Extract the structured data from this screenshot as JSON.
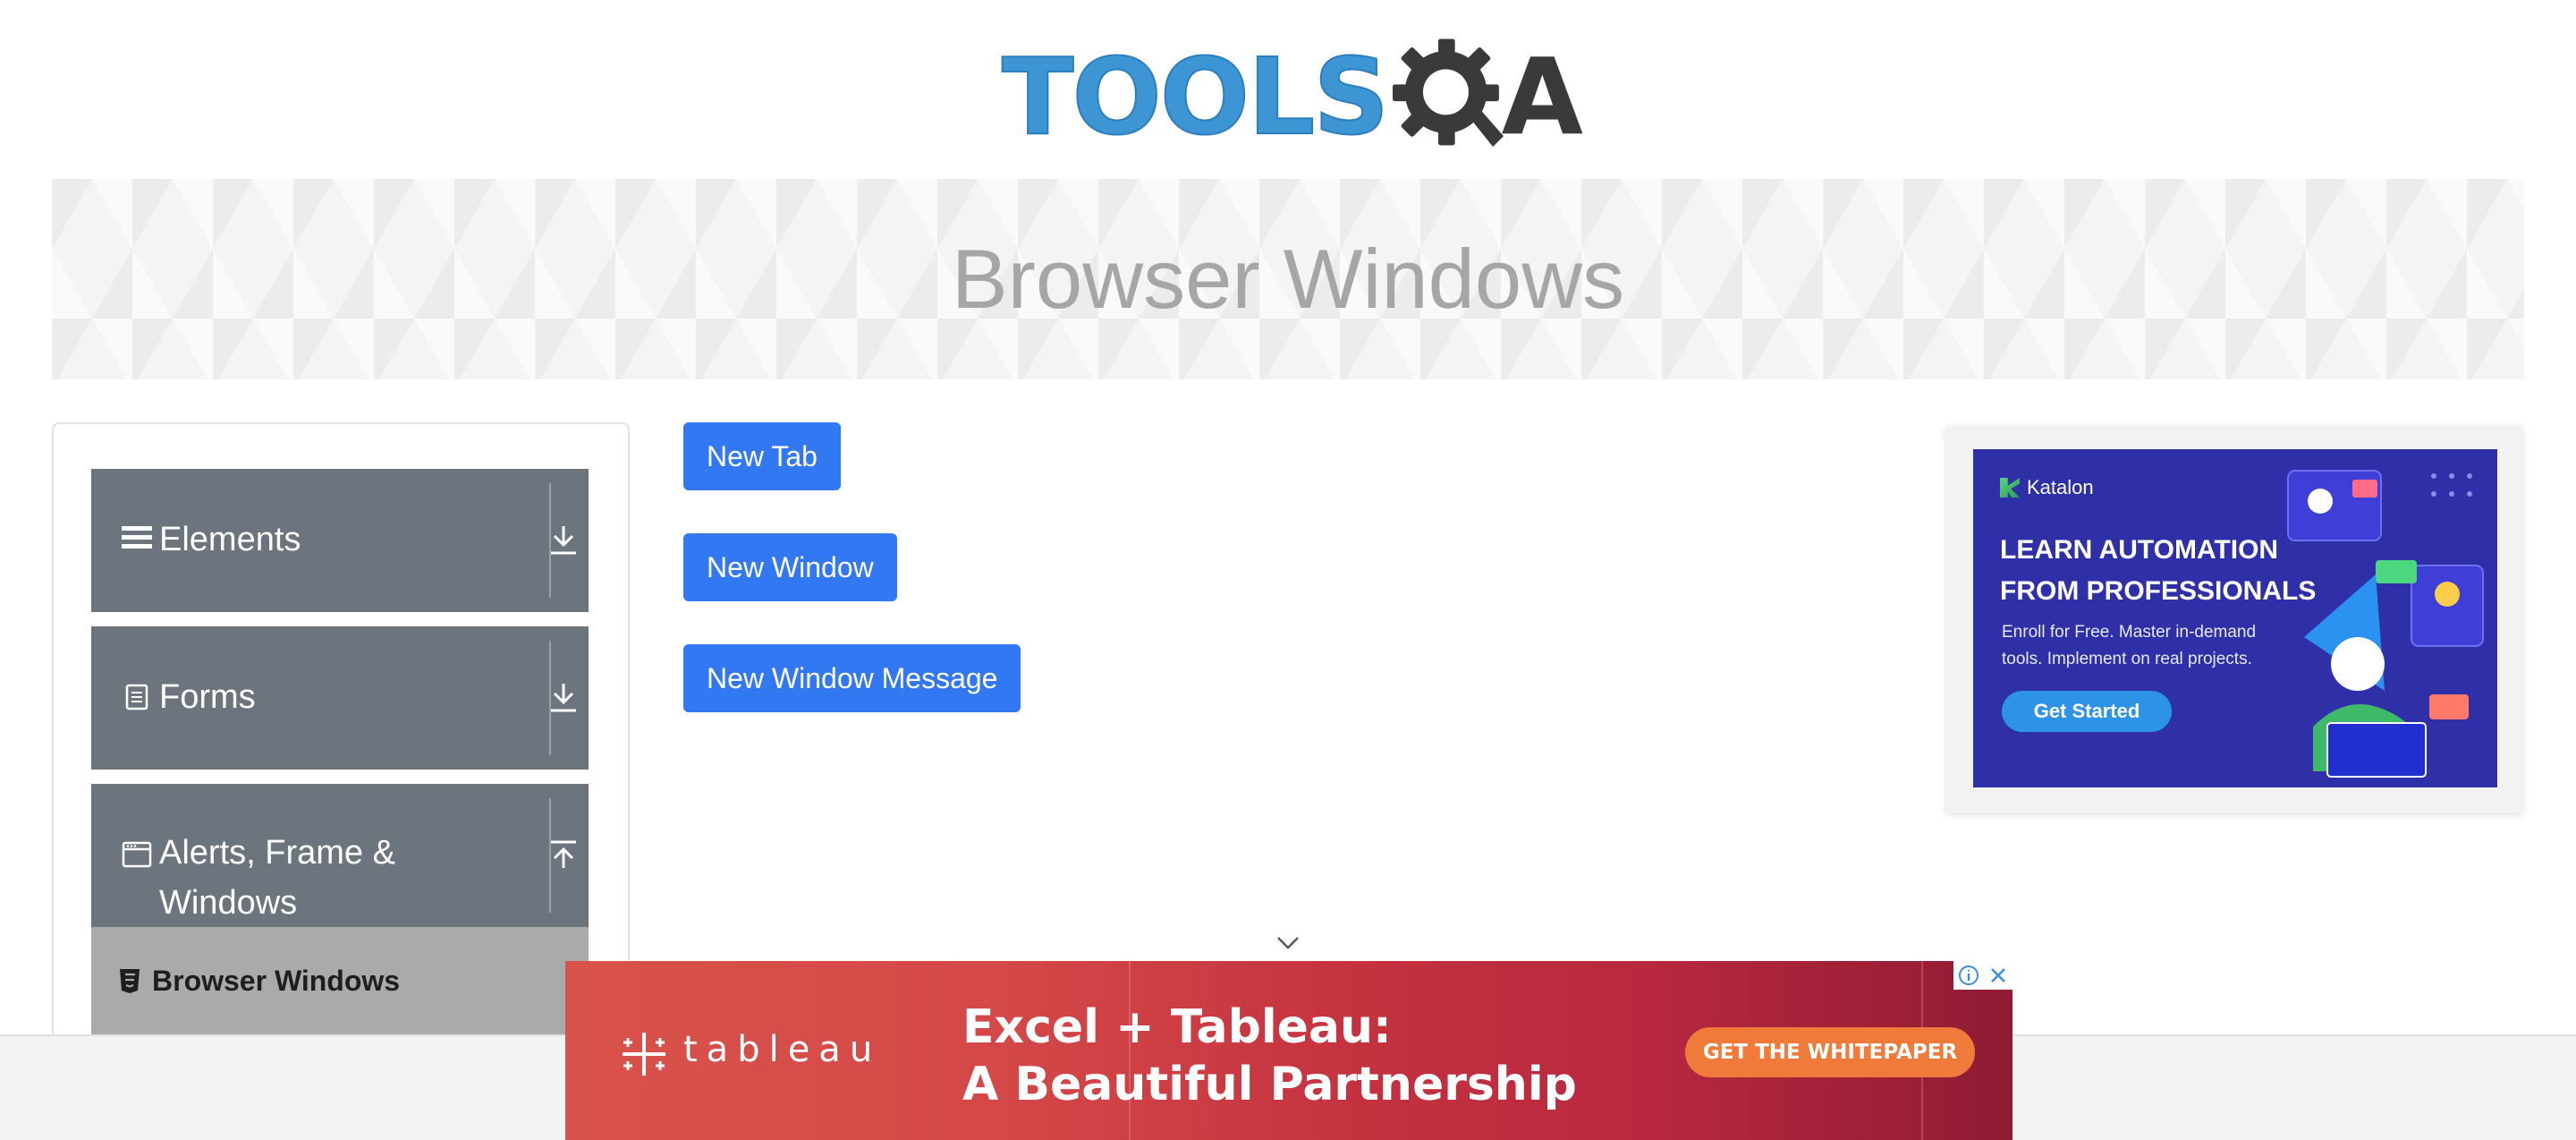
{
  "logo": {
    "text": "TOOLS",
    "suffix": "A"
  },
  "header": {
    "title": "Browser Windows"
  },
  "sidebar": {
    "groups": [
      {
        "label": "Elements",
        "icon": "hamburger-icon",
        "toggle": "download-icon"
      },
      {
        "label": "Forms",
        "icon": "document-icon",
        "toggle": "download-icon"
      },
      {
        "label": "Alerts, Frame &",
        "label2": "Windows",
        "icon": "window-icon",
        "toggle": "upload-icon"
      }
    ],
    "active_item": {
      "label": "Browser Windows",
      "icon": "html5-icon"
    }
  },
  "buttons": {
    "new_tab": "New Tab",
    "new_window": "New Window",
    "new_window_message": "New Window Message"
  },
  "right_ad": {
    "brand": "Katalon",
    "headline_line1": "LEARN AUTOMATION",
    "headline_line2": "FROM PROFESSIONALS",
    "sub_line1": "Enroll for Free. Master in-demand",
    "sub_line2": "tools. Implement on real projects.",
    "cta": "Get Started"
  },
  "bottom_ad": {
    "brand": "tableau",
    "headline_line1": "Excel + Tableau:",
    "headline_line2": "A Beautiful Partnership",
    "cta": "GET THE WHITEPAPER"
  },
  "colors": {
    "primary_button": "#3278f2",
    "sidebar_group": "#6c757d",
    "sidebar_active": "#aaaaaa",
    "logo_blue": "#3d95d4",
    "ad_blue": "#2f2fa8",
    "ad_red": "#c4323f",
    "cta_orange": "#ef7a3a"
  }
}
